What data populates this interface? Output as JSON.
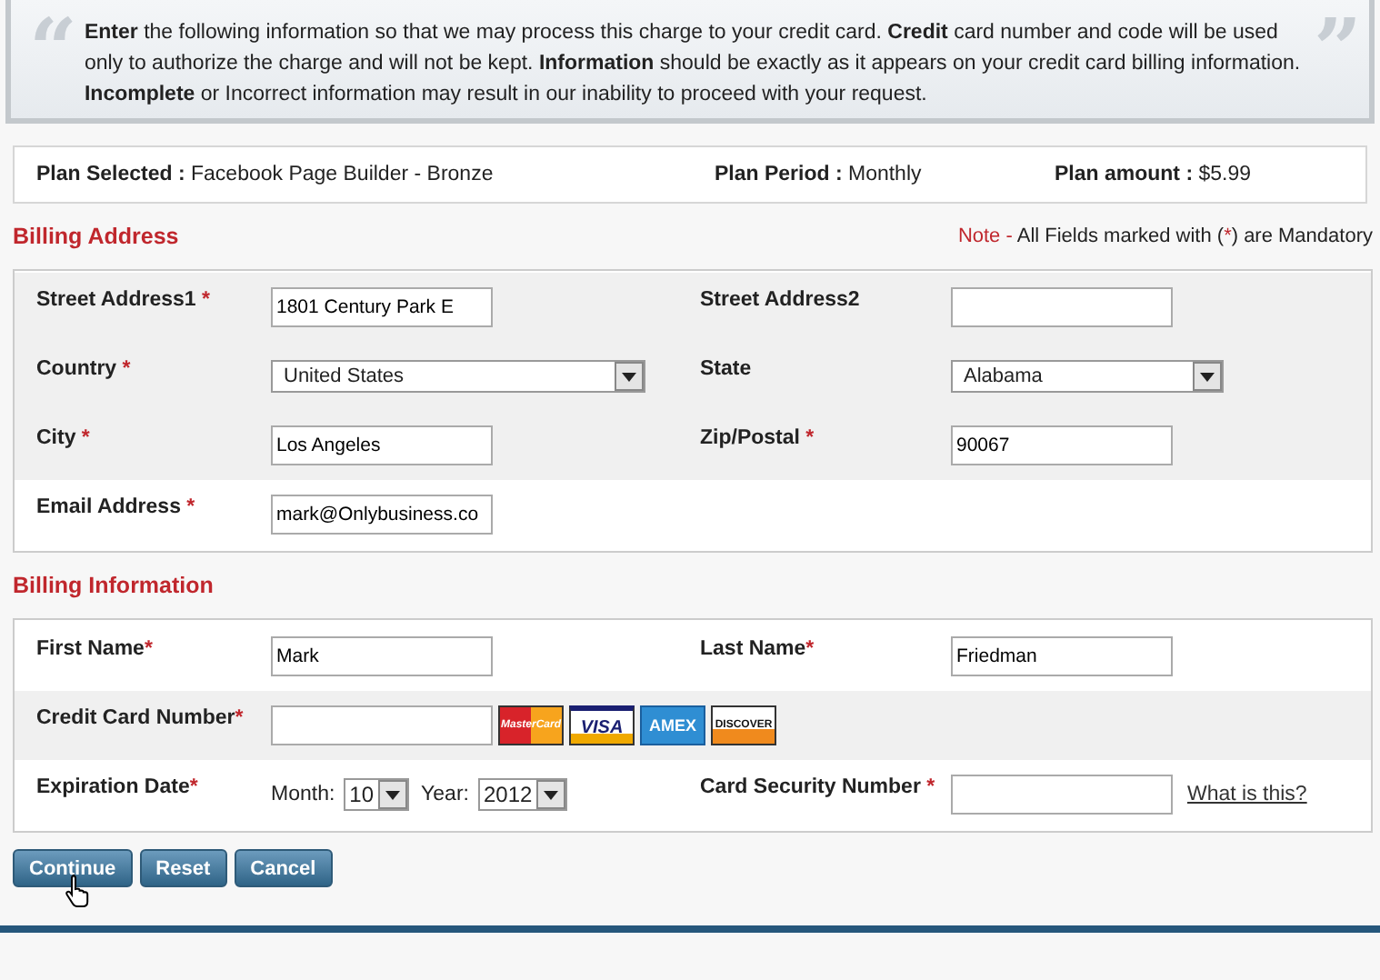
{
  "intro": {
    "open_quote": "“",
    "close_quote": "”",
    "text": "**Enter** the following information so that we may process this charge to your credit card. **Credit** card number and code will be used only to authorize the charge and will not be kept. **Information** should be exactly as it appears on your credit card billing information. **Incomplete** or Incorrect information may result in our inability to proceed with your request."
  },
  "plan": [
    {
      "label": "Plan Selected :",
      "value": "Facebook Page Builder - Bronze"
    },
    {
      "label": "Plan Period :",
      "value": "Monthly"
    },
    {
      "label": "Plan amount :",
      "value": "$5.99"
    }
  ],
  "sections": [
    {
      "title": "Billing Address",
      "note": [
        {
          "text": "Note -",
          "kind": "accent"
        },
        {
          "text": " All Fields marked with (",
          "kind": "plain"
        },
        {
          "text": "*",
          "kind": "accent"
        },
        {
          "text": ") are Mandatory",
          "kind": "plain"
        }
      ],
      "rows": [
        {
          "shaded": true,
          "cells": [
            {
              "label": "Street Address1",
              "required_mark": " *",
              "fields": [
                {
                  "kind": "text",
                  "value": "1801 Century Park E"
                }
              ]
            },
            {
              "label": "Street Address2",
              "fields": [
                {
                  "kind": "text"
                }
              ]
            }
          ]
        },
        {
          "shaded": true,
          "cells": [
            {
              "label": "Country",
              "required_mark": " *",
              "fields": [
                {
                  "kind": "select-wide",
                  "value": "United States"
                }
              ]
            },
            {
              "label": "State",
              "fields": [
                {
                  "kind": "select",
                  "value": "Alabama"
                }
              ]
            }
          ]
        },
        {
          "shaded": true,
          "cells": [
            {
              "label": "City",
              "required_mark": " *",
              "fields": [
                {
                  "kind": "text",
                  "value": "Los Angeles"
                }
              ]
            },
            {
              "label": "Zip/Postal",
              "required_mark": " *",
              "fields": [
                {
                  "kind": "text",
                  "value": "90067"
                }
              ]
            }
          ]
        },
        {
          "shaded": false,
          "cells": [
            {
              "label": "Email Address",
              "required_mark": " *",
              "fields": [
                {
                  "kind": "text",
                  "value": "mark@Onlybusiness.co"
                }
              ]
            }
          ]
        }
      ]
    },
    {
      "title": "Billing Information",
      "rows": [
        {
          "shaded": false,
          "cells": [
            {
              "label": "First Name",
              "required_mark": "*",
              "fields": [
                {
                  "kind": "text",
                  "value": "Mark"
                }
              ]
            },
            {
              "label": "Last Name",
              "required_mark": "*",
              "fields": [
                {
                  "kind": "text",
                  "value": "Friedman"
                }
              ]
            }
          ]
        },
        {
          "shaded": true,
          "cells": [
            {
              "label": "Credit Card Number",
              "required_mark": "*",
              "fields": [
                {
                  "kind": "text"
                },
                {
                  "kind": "cards",
                  "cards": [
                    "MasterCard",
                    "VISA",
                    "AMEX",
                    "DISCOVER"
                  ]
                }
              ]
            }
          ]
        },
        {
          "shaded": false,
          "cells": [
            {
              "label": "Expiration Date",
              "required_mark": "*",
              "fields": [
                {
                  "kind": "caption",
                  "text": "Month:"
                },
                {
                  "kind": "select-small",
                  "value": "10"
                },
                {
                  "kind": "caption",
                  "text": "Year:"
                },
                {
                  "kind": "select-small",
                  "value": "2012"
                }
              ]
            },
            {
              "label": "Card Security Number",
              "required_mark": " *",
              "fields": [
                {
                  "kind": "text"
                },
                {
                  "kind": "link",
                  "text": "What is this?"
                }
              ]
            }
          ]
        }
      ]
    }
  ],
  "buttons": [
    {
      "label": "Continue",
      "hovered": true
    },
    {
      "label": "Reset",
      "hovered": false
    },
    {
      "label": "Cancel",
      "hovered": false
    }
  ]
}
